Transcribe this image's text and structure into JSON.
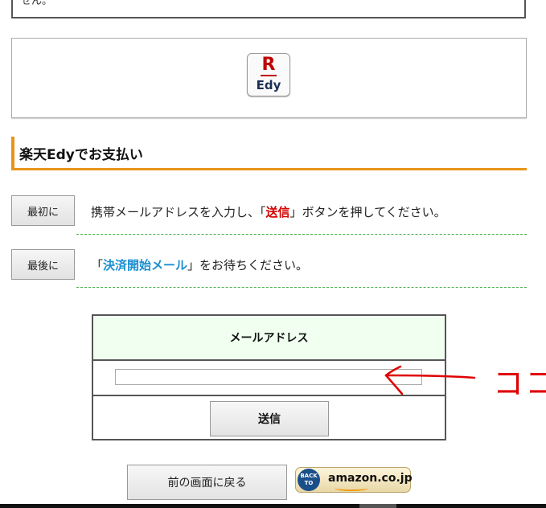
{
  "top_notice": {
    "text": "せん。"
  },
  "logo": {
    "mark": "R",
    "text": "Edy"
  },
  "heading": {
    "title": "楽天Edyでお支払い"
  },
  "steps": [
    {
      "button": "最初に",
      "text_before": "携帯メールアドレスを入力し、「",
      "highlight": "送信",
      "text_after": "」ボタンを押してください。"
    },
    {
      "button": "最後に",
      "text_before": "「",
      "highlight": "決済開始メール",
      "text_after": "」をお待ちください。"
    }
  ],
  "mail_form": {
    "header": "メールアドレス",
    "email_value": "",
    "submit_label": "送信"
  },
  "footer": {
    "back_label": "前の画面に戻る",
    "amazon_back_to": "BACK TO",
    "amazon_label": "amazon.co.jp"
  },
  "annotation": {
    "text": "ココ"
  },
  "colors": {
    "accent_orange": "#e8941a",
    "highlight_red": "#d40000",
    "highlight_blue": "#1a8ed0",
    "dashed_green": "#4cae4c",
    "form_header_bg": "#f0fff0",
    "annotation_red": "#e00000"
  }
}
